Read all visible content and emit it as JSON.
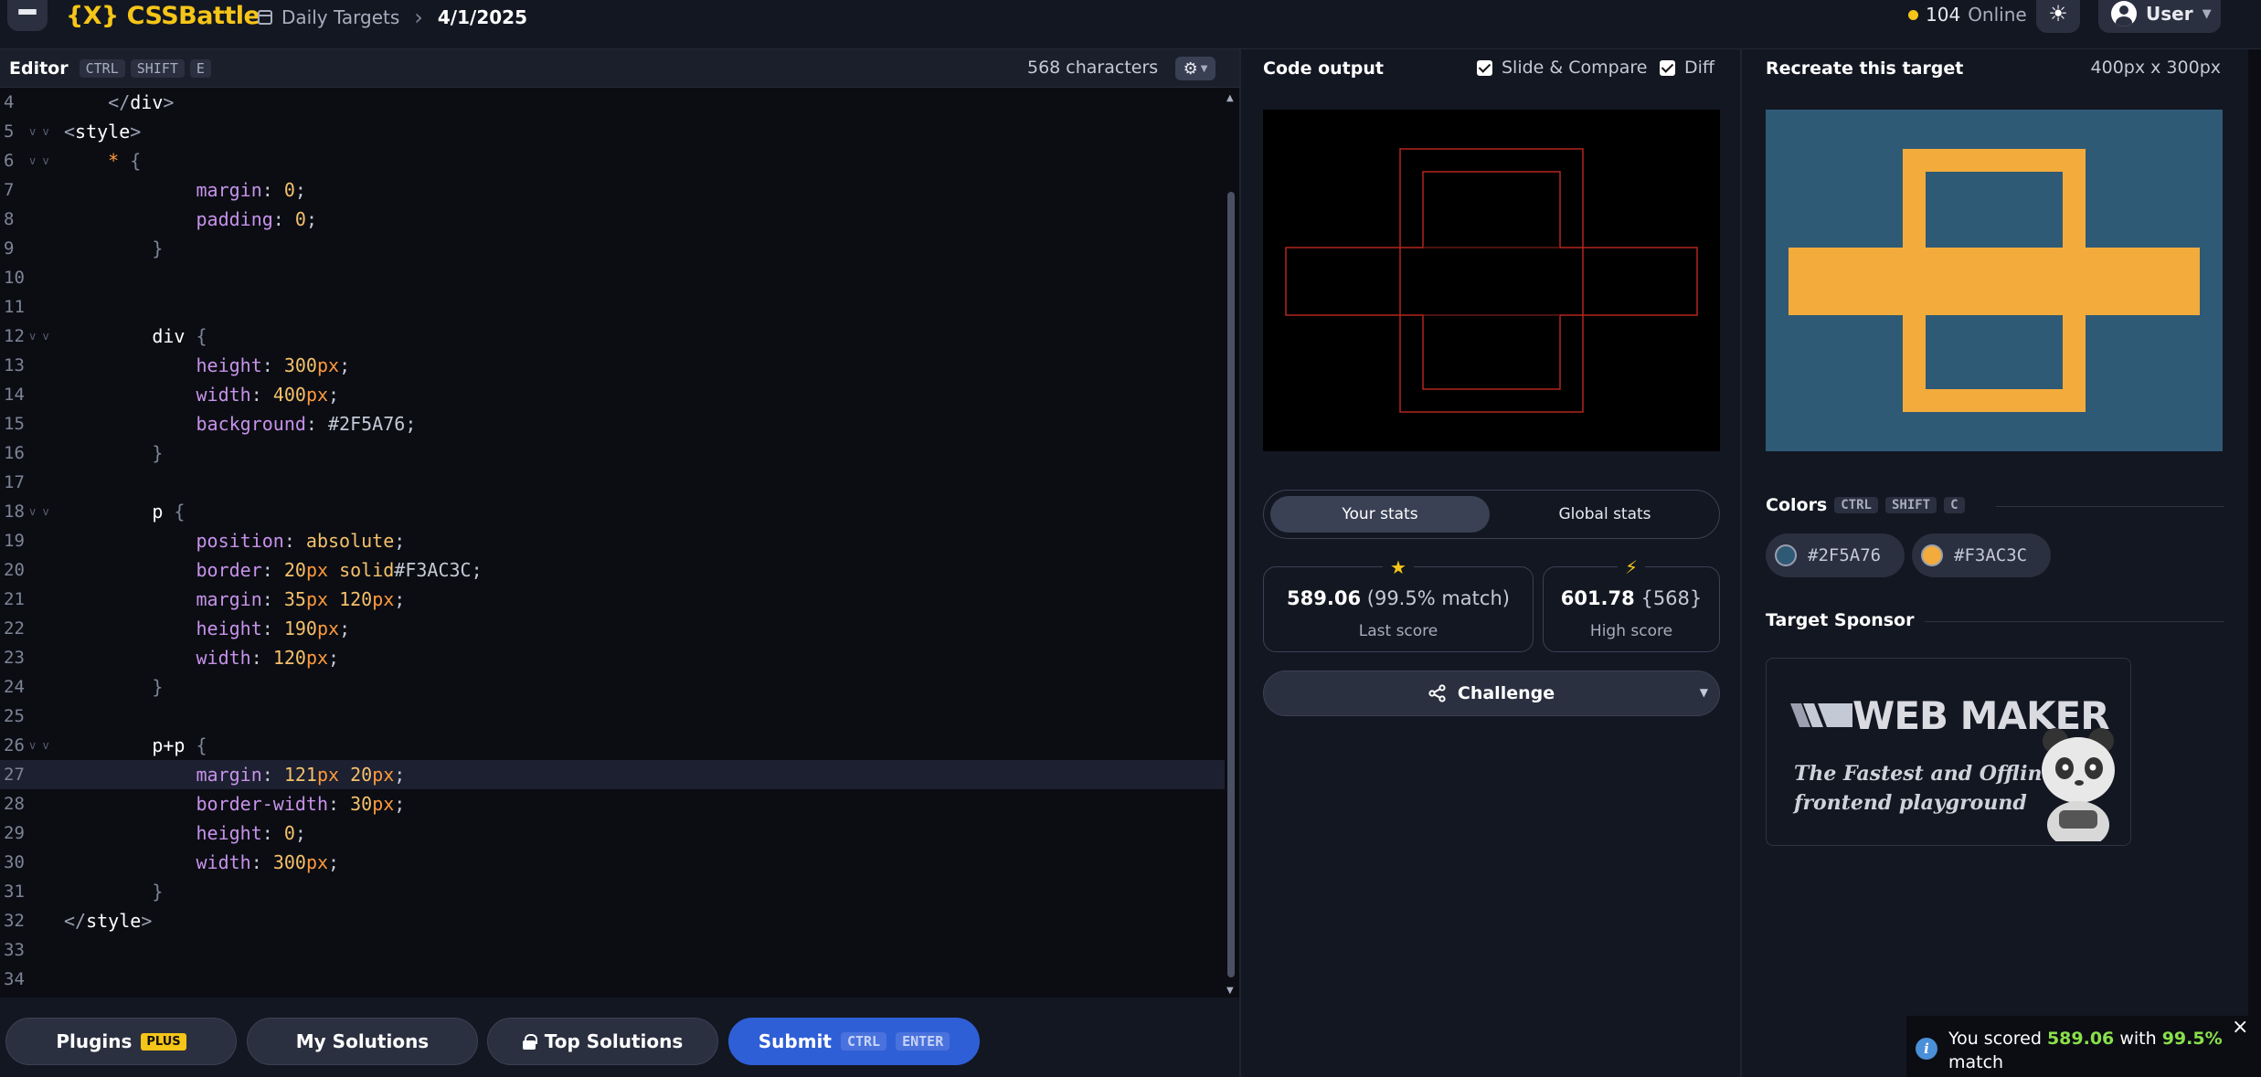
{
  "header": {
    "logo": "{X} CSSBattle",
    "breadcrumb_section": "Daily Targets",
    "breadcrumb_date": "4/1/2025",
    "online_count": "104",
    "online_label": "Online",
    "user_label": "User",
    "icons": [
      "menu-icon",
      "calendar-icon",
      "chevron-right-icon",
      "sun-icon",
      "user-avatar-icon",
      "caret-down-icon"
    ]
  },
  "editor": {
    "title": "Editor",
    "shortcut": [
      "CTRL",
      "SHIFT",
      "E"
    ],
    "char_count": "568 characters",
    "lines": [
      {
        "n": "4",
        "text": "    </div>"
      },
      {
        "n": "5",
        "text": "<style>"
      },
      {
        "n": "6",
        "text": "    * {"
      },
      {
        "n": "7",
        "text": "            margin: 0;"
      },
      {
        "n": "8",
        "text": "            padding: 0;"
      },
      {
        "n": "9",
        "text": "        }"
      },
      {
        "n": "10",
        "text": ""
      },
      {
        "n": "11",
        "text": ""
      },
      {
        "n": "12",
        "text": "        div {"
      },
      {
        "n": "13",
        "text": "            height: 300px;"
      },
      {
        "n": "14",
        "text": "            width: 400px;"
      },
      {
        "n": "15",
        "text": "            background: #2F5A76;"
      },
      {
        "n": "16",
        "text": "        }"
      },
      {
        "n": "17",
        "text": ""
      },
      {
        "n": "18",
        "text": "        p {"
      },
      {
        "n": "19",
        "text": "            position: absolute;"
      },
      {
        "n": "20",
        "text": "            border: 20px solid#F3AC3C;"
      },
      {
        "n": "21",
        "text": "            margin: 35px 120px;"
      },
      {
        "n": "22",
        "text": "            height: 190px;"
      },
      {
        "n": "23",
        "text": "            width: 120px;"
      },
      {
        "n": "24",
        "text": "        }"
      },
      {
        "n": "25",
        "text": ""
      },
      {
        "n": "26",
        "text": "        p+p {"
      },
      {
        "n": "27",
        "text": "            margin: 121px 20px;"
      },
      {
        "n": "28",
        "text": "            border-width: 30px;"
      },
      {
        "n": "29",
        "text": "            height: 0;"
      },
      {
        "n": "30",
        "text": "            width: 300px;"
      },
      {
        "n": "31",
        "text": "        }"
      },
      {
        "n": "32",
        "text": "</style>"
      },
      {
        "n": "33",
        "text": ""
      },
      {
        "n": "34",
        "text": ""
      }
    ],
    "folded_lines": [
      "5",
      "6",
      "12",
      "18",
      "26"
    ],
    "active_line": "27"
  },
  "bottom_bar": {
    "plugins": "Plugins",
    "plugins_badge": "PLUS",
    "my_solutions": "My Solutions",
    "top_solutions": "Top Solutions",
    "submit": "Submit",
    "submit_keys": [
      "CTRL",
      "ENTER"
    ]
  },
  "output": {
    "title": "Code output",
    "slide_compare": "Slide & Compare",
    "slide_compare_checked": true,
    "diff": "Diff",
    "diff_checked": true,
    "stats_tabs": [
      "Your stats",
      "Global stats"
    ],
    "active_tab": "Your stats",
    "last_score_value": "589.06",
    "last_score_match": "(99.5% match)",
    "last_score_label": "Last score",
    "high_score_value": "601.78",
    "high_score_chars": "{568}",
    "high_score_label": "High score",
    "challenge": "Challenge",
    "diff_line_color": "#b3261e"
  },
  "target": {
    "title": "Recreate this target",
    "dims": "400px x 300px",
    "colors_title": "Colors",
    "colors_shortcut": [
      "CTRL",
      "SHIFT",
      "C"
    ],
    "colors": [
      "#2F5A76",
      "#F3AC3C"
    ],
    "sponsor_title": "Target Sponsor",
    "sponsor_name": "WEB MAKER",
    "sponsor_tagline_1": "The Fastest and Offline",
    "sponsor_tagline_2": "frontend playground"
  },
  "toast": {
    "prefix": "You scored",
    "score": "589.06",
    "middle": "with",
    "match": "99.5%",
    "suffix": "match"
  }
}
